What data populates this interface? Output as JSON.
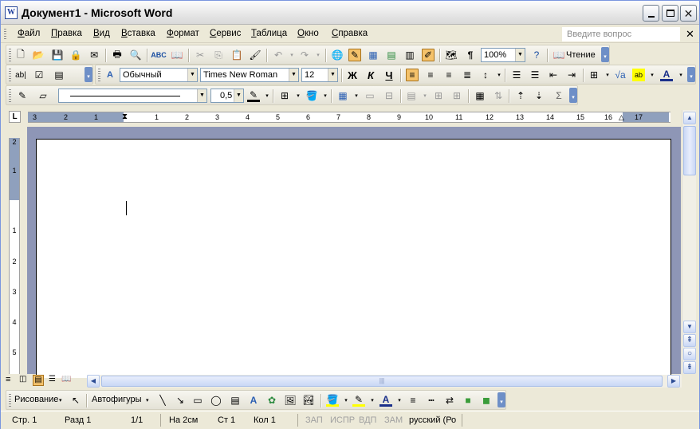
{
  "window": {
    "title": "Документ1 - Microsoft Word"
  },
  "menu": {
    "items": [
      "Файл",
      "Правка",
      "Вид",
      "Вставка",
      "Формат",
      "Сервис",
      "Таблица",
      "Окно",
      "Справка"
    ],
    "ask_placeholder": "Введите вопрос"
  },
  "standard_toolbar": {
    "zoom": "100%",
    "reading_label": "Чтение"
  },
  "formatting_toolbar": {
    "style": "Обычный",
    "font": "Times New Roman",
    "size": "12",
    "bold": "Ж",
    "italic": "К",
    "underline": "Ч"
  },
  "tables_toolbar": {
    "line_weight": "0,5"
  },
  "ruler": {
    "corner": "L",
    "h_numbers": [
      "3",
      "2",
      "1",
      "1",
      "2",
      "3",
      "4",
      "5",
      "6",
      "7",
      "8",
      "9",
      "10",
      "11",
      "12",
      "13",
      "14",
      "15",
      "16",
      "17"
    ],
    "v_numbers": [
      "2",
      "1",
      "1",
      "2",
      "3",
      "4",
      "5"
    ]
  },
  "drawing_toolbar": {
    "drawing_label": "Рисование",
    "autoshapes_label": "Автофигуры"
  },
  "status_bar": {
    "page": "Стр.  1",
    "section": "Разд  1",
    "pages": "1/1",
    "at": "На  2см",
    "line": "Ст  1",
    "col": "Кол  1",
    "rec": "ЗАП",
    "trk": "ИСПР",
    "ext": "ВДП",
    "ovr": "ЗАМ",
    "language": "русский (Ро"
  },
  "colors": {
    "accent": "#f4c26b",
    "doc_background": "#8e96b6",
    "ruler_margin": "#8fa0bd"
  }
}
